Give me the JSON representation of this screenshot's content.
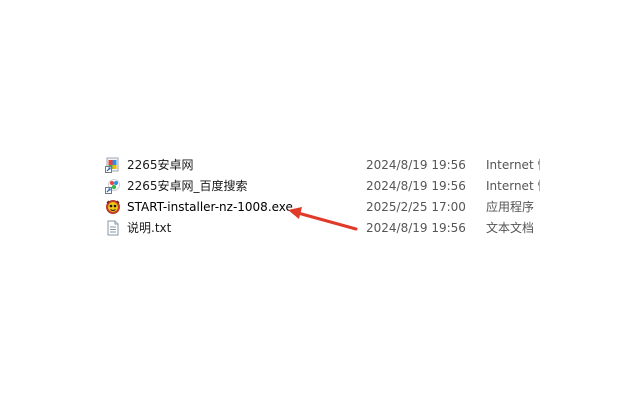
{
  "files": [
    {
      "name": "2265安卓网",
      "date": "2024/8/19 19:56",
      "type": "Internet 快捷方式",
      "icon": "url-shortcut-icon"
    },
    {
      "name": "2265安卓网_百度搜索",
      "date": "2024/8/19 19:56",
      "type": "Internet 快捷方式",
      "icon": "url-shortcut-icon"
    },
    {
      "name": "START-installer-nz-1008.exe",
      "date": "2025/2/25 17:00",
      "type": "应用程序",
      "icon": "installer-icon"
    },
    {
      "name": "说明.txt",
      "date": "2024/8/19 19:56",
      "type": "文本文档",
      "icon": "text-file-icon"
    }
  ],
  "annotation": {
    "arrow_color": "#e03a28",
    "points_to": "START-installer-nz-1008.exe"
  }
}
